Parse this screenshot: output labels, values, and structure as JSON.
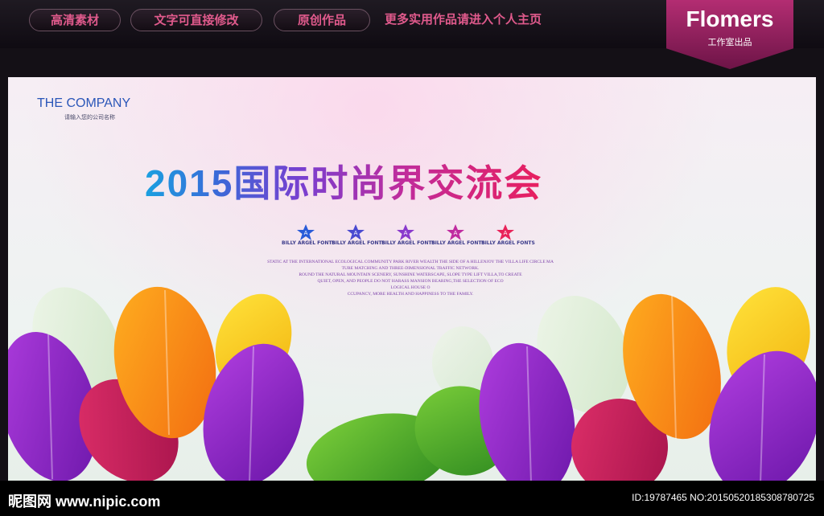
{
  "topbar": {
    "tags": [
      "高清素材",
      "文字可直接修改",
      "原创作品"
    ],
    "note": "更多实用作品请进入个人主页"
  },
  "badge": {
    "title": "Flomers",
    "subtitle": "工作室出品"
  },
  "poster": {
    "company": "THE COMPANY",
    "company_sub": "请输入您的公司名称",
    "headline": "2015国际时尚界交流会",
    "stars": [
      {
        "letter": "A",
        "label": "BILLY ARGEL FONTS",
        "color": "#2a5cd8"
      },
      {
        "letter": "A",
        "label": "BILLY ARGEL FONTS",
        "color": "#4a4ad0"
      },
      {
        "letter": "A",
        "label": "BILLY ARGEL FONTS",
        "color": "#8a3acc"
      },
      {
        "letter": "A",
        "label": "BILLY ARGEL FONTS",
        "color": "#c02ca0"
      },
      {
        "letter": "A",
        "label": "BILLY ARGEL FONTS",
        "color": "#e8245a"
      }
    ],
    "paragraph": [
      "STATIC AT THE INTERNATIONAL ECOLOGICAL COMMUNITY PARK RIVER WEALTH THE SIDE OF A HILLENJOY THE VILLA LIFE CIRCLE MA",
      "TURE MATCHING AND THREE-DIMENSIONAL TRAFFIC NETWORK.",
      "ROUND THE NATURAL MOUNTAIN SCENERY, SUNSHINE WATERSCAPE, SLOPE TYPE LIFT VILLA,TO CREATE",
      "QUIET, OPEN, AND PEOPLE DO NOT HARASS MANSION BEARING,THE SELECTION OF ECO",
      "LOGICAL HOUSE O",
      "CCUPANCY, MORE HEALTH AND HAPPINESS TO THE FAMILY."
    ]
  },
  "footer": {
    "site": "昵图网 www.nipic.com",
    "id_line": "ID:19787465 NO:20150520185308780725"
  },
  "colors": {
    "accent": "#e05a8c",
    "badge": "#9e2264"
  }
}
